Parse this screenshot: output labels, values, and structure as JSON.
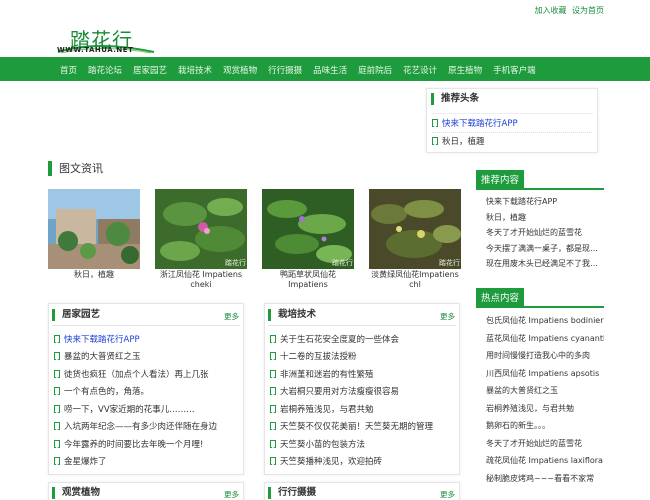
{
  "header": {
    "top_links": [
      "加入收藏",
      "设为首页"
    ],
    "logo_cn": "踏花行",
    "logo_en": "WWW.TAHUA.NET"
  },
  "nav": [
    "首页",
    "踏花论坛",
    "居家园艺",
    "栽培技术",
    "观赏植物",
    "行行摄摄",
    "品味生活",
    "庭前院后",
    "花艺设计",
    "原生植物",
    "手机客户端"
  ],
  "recommend_top": {
    "title": "推荐头条",
    "items": [
      "快来下载踏花行APP",
      "秋日，植趣"
    ]
  },
  "gallery": {
    "title": "图文资讯",
    "items": [
      {
        "caption": "秋日，植趣"
      },
      {
        "caption": "浙江凤仙花 Impatiens cheki"
      },
      {
        "caption": "鸭跖草状凤仙花 Impatiens"
      },
      {
        "caption": "淡黄绿凤仙花Impatiens chl"
      }
    ],
    "watermark": "踏花行"
  },
  "home_garden": {
    "title": "居家园艺",
    "more": "更多",
    "items": [
      "快来下载踏花行APP",
      "暴盆的大普贤红之玉",
      "徒货也疯狂（加点个人看法）再上几张",
      "一个有点色的，角落。",
      "唠一下，VV家近期的花事儿………",
      "入坑两年纪念——有多少肉还伴随在身边",
      "今年露养的时间要比去年晚一个月哩!",
      "金星爆炸了"
    ]
  },
  "cultivation": {
    "title": "栽培技术",
    "more": "更多",
    "items": [
      "关于生石花安全度夏的一些体会",
      "十二卷的互拔法授粉",
      "非洲堇和迷岩的有性繁殖",
      "大岩桐只要用对方法瘦瘦很容易",
      "岩桐养殖浅见，与君共勉",
      "天竺葵不仅仅花美丽！天竺葵无期的管理",
      "天竺葵小苗的包装方法",
      "天竺葵播种浅见，欢迎拍砖"
    ]
  },
  "ornamental": {
    "title": "观赏植物",
    "more": "更多"
  },
  "photography": {
    "title": "行行摄摄",
    "more": "更多"
  },
  "side_recommend": {
    "title": "推荐内容",
    "items": [
      "快来下载踏花行APP",
      "秋日，植趣",
      "冬天了才开始灿烂的蓝雪花",
      "今天摆了满满一桌子，都是现…",
      "现在用废木头已经满足不了我…"
    ]
  },
  "side_hot": {
    "title": "热点内容",
    "items": [
      "包氏凤仙花 Impatiens bodinieri",
      "蓝花凤仙花 Impatiens cyanantha",
      "用时间慢慢打造我心中的多肉",
      "川西凤仙花 Impatiens apsotis",
      "暴盆的大普贤红之玉",
      "岩桐养殖浅见，与君共勉",
      "鹅卵石的新生。。。",
      "冬天了才开始灿烂的蓝雪花",
      "疏花凤仙花 Impatiens laxiflora",
      "秘制脆皮烤鸡~~~看看不家常"
    ]
  }
}
